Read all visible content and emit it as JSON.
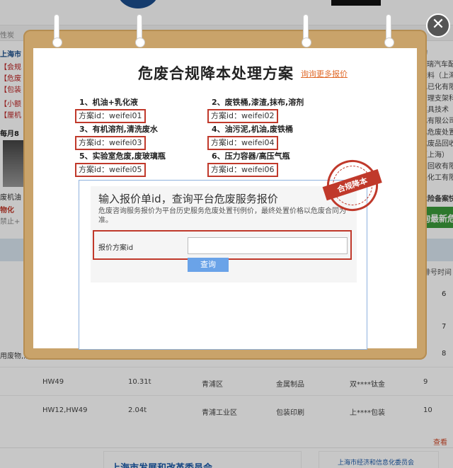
{
  "background": {
    "nav_text": "性炭",
    "left_items": [
      "上海市",
      "【会规",
      "【危废",
      "【包装",
      "【小额",
      "【厘机"
    ],
    "month_label": "每月8",
    "left_bottom": [
      "废机油",
      "物化",
      "禁止+"
    ],
    "right_header": "约",
    "right_items": [
      "⑤瑞汽车配",
      "涂料（上海）",
      "色已化有限",
      "管理支架科",
      "模具技术",
      "化有限公司",
      "化危废处置",
      "式废品回收",
      "（上海）",
      "田回收有限",
      "美化工有限"
    ],
    "right_section": "危险备案快",
    "right_green": "询最新危",
    "right_col_header": "排号时间",
    "left_row_text": "用废物,活",
    "rows": [
      {
        "code": "HW49",
        "weight": "10.31t",
        "district": "青浦区",
        "industry": "金属制品",
        "company": "双****钛金",
        "num": "9"
      },
      {
        "code": "HW12,HW49",
        "weight": "2.04t",
        "district": "青浦工业区",
        "industry": "包装印刷",
        "company": "上****包装",
        "num": "10"
      }
    ],
    "upper_nums": [
      "6",
      "7",
      "8"
    ],
    "more": "查看",
    "footer_card1": "上海市发展和改革委员会",
    "footer_card2": "上海市经济和信息化委员会"
  },
  "modal": {
    "title": "危废合规降本处理方案",
    "more_link": "询询更多报价",
    "close_symbol": "✕",
    "plans": [
      {
        "name": "1、机油+乳化液",
        "id": "方案id：weifei01"
      },
      {
        "name": "2、废铁桶,漆渣,抹布,溶剂",
        "id": "方案id：weifei02"
      },
      {
        "name": "3、有机溶剂,清洗废水",
        "id": "方案id：weifei03"
      },
      {
        "name": "4、油污泥,机油,废铁桶",
        "id": "方案id：weifei04"
      },
      {
        "name": "5、实验室危废,废玻璃瓶",
        "id": "方案id：weifei05"
      },
      {
        "name": "6、压力容器/高压气瓶",
        "id": "方案id：weifei06"
      }
    ],
    "stamp_text": "合规降本",
    "query": {
      "title": "输入报价单id，查询平台危废服务报价",
      "desc": "危废咨询服务报价为平台历史服务危废处置刊例价，最终处置价格以危废合同为准。",
      "input_label": "报价方案id",
      "input_value": "",
      "input_placeholder": "",
      "button_label": "查询"
    }
  }
}
